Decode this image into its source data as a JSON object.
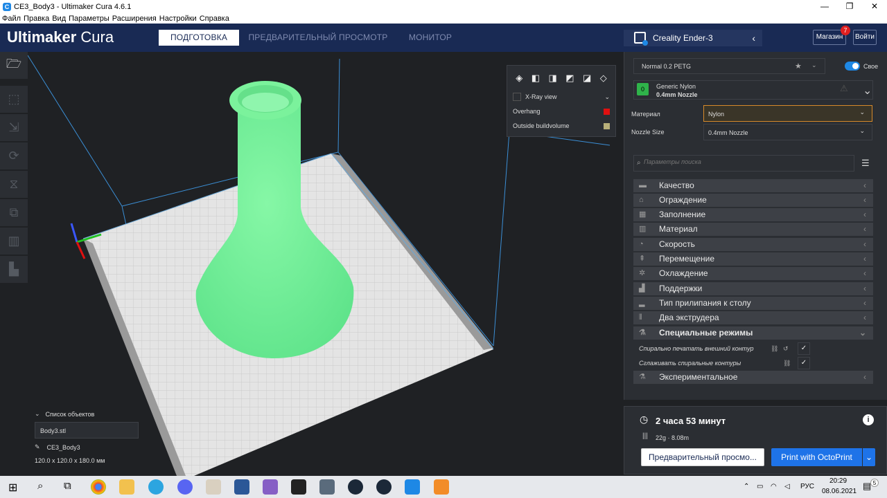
{
  "window": {
    "title": "CE3_Body3 - Ultimaker Cura 4.6.1",
    "minimize": "—",
    "maximize": "❐",
    "close": "✕"
  },
  "menu": [
    "Файл",
    "Правка",
    "Вид",
    "Параметры",
    "Расширения",
    "Настройки",
    "Справка"
  ],
  "header": {
    "logo_bold": "Ultimaker",
    "logo_light": "Cura",
    "tabs": [
      "ПОДГОТОВКА",
      "ПРЕДВАРИТЕЛЬНЫЙ ПРОСМОТР",
      "МОНИТОР"
    ],
    "active_tab": 0,
    "printer": "Creality Ender-3",
    "marketplace": "Магазин",
    "marketplace_badge": "7",
    "signin": "Войти"
  },
  "view_panel": {
    "xray": "X-Ray view",
    "overhang": "Overhang",
    "overhang_color": "#e01010",
    "outside": "Outside buildvolume",
    "outside_color": "#b8b07a"
  },
  "print_setup": {
    "profile": "Normal 0.2 PETG",
    "custom": "Свое",
    "extruder_material": "Generic Nylon",
    "extruder_nozzle": "0.4mm Nozzle",
    "material_label": "Материал",
    "material_value": "Nylon",
    "nozzle_label": "Nozzle Size",
    "nozzle_value": "0.4mm Nozzle",
    "search_placeholder": "Параметры поиска",
    "categories": [
      {
        "label": "Качество",
        "icon": "▬"
      },
      {
        "label": "Ограждение",
        "icon": "⌂"
      },
      {
        "label": "Заполнение",
        "icon": "▦"
      },
      {
        "label": "Материал",
        "icon": "▥"
      },
      {
        "label": "Скорость",
        "icon": "◔"
      },
      {
        "label": "Перемещение",
        "icon": "⇞"
      },
      {
        "label": "Охлаждение",
        "icon": "✲"
      },
      {
        "label": "Поддержки",
        "icon": "▟"
      },
      {
        "label": "Тип прилипания к столу",
        "icon": "▂"
      },
      {
        "label": "Два экструдера",
        "icon": "⫴"
      },
      {
        "label": "Специальные режимы",
        "icon": "⚗"
      },
      {
        "label": "Экспериментальное",
        "icon": "⚗"
      }
    ],
    "special_settings": [
      "Спирально печатать внешний контур",
      "Сглаживать спиральные контуры"
    ]
  },
  "objects": {
    "header": "Список объектов",
    "file": "Body3.stl",
    "object": "CE3_Body3",
    "dimensions": "120.0 x 120.0 x 180.0 мм"
  },
  "estimate": {
    "time": "2 часа 53 минут",
    "material": "22g · 8.08m",
    "preview_button": "Предварительный просмо...",
    "print_button": "Print with OctoPrint"
  },
  "taskbar": {
    "lang": "РУС",
    "time": "20:29",
    "date": "08.06.2021",
    "notifications": "5"
  }
}
